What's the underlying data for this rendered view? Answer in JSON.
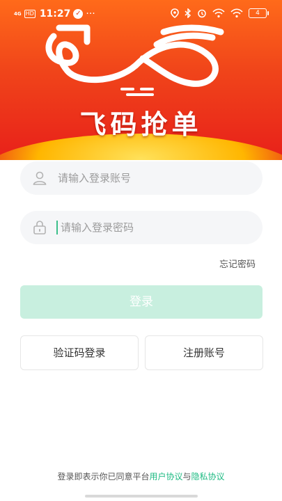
{
  "status_bar": {
    "network": "4G",
    "hd": "HD",
    "time": "11:27",
    "more": "···",
    "battery": "4"
  },
  "app": {
    "name": "飞码抢单"
  },
  "login": {
    "account_placeholder": "请输入登录账号",
    "password_placeholder": "请输入登录密码",
    "forgot_password": "忘记密码",
    "login_button": "登录",
    "sms_login_button": "验证码登录",
    "register_button": "注册账号"
  },
  "agreement": {
    "prefix": "登录即表示你已同意平台",
    "user_agreement": "用户协议",
    "and": "与",
    "privacy_policy": "隐私协议"
  },
  "colors": {
    "accent": "#1fbb83",
    "login_button_bg": "#c8efdf",
    "banner_top": "#ff6a1a",
    "banner_bottom": "#e8201a"
  },
  "icons": {
    "account": "user-icon",
    "password": "lock-icon"
  }
}
